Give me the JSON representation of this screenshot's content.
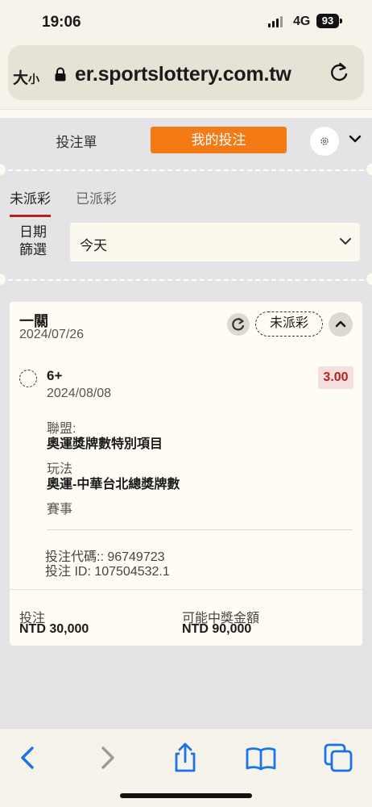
{
  "status_bar": {
    "time": "19:06",
    "network": "4G",
    "battery": "93"
  },
  "browser": {
    "text_size_label": "大",
    "text_size_small": "小",
    "url": "er.sportslottery.com.tw"
  },
  "tabs": {
    "betslip": "投注單",
    "my_bets": "我的投注"
  },
  "subtabs": {
    "unsettled": "未派彩",
    "settled": "已派彩"
  },
  "filter": {
    "label": "日期\n篩選",
    "label_line1": "日期",
    "label_line2": "篩選",
    "value": "今天"
  },
  "bet": {
    "type": "一關",
    "date": "2024/07/26",
    "status": "未派彩",
    "selection": {
      "name": "6+",
      "date": "2024/08/08",
      "odds": "3.00",
      "league_label": "聯盟:",
      "league": "奧運獎牌數特別項目",
      "market_label": "玩法",
      "market": "奧運-中華台北總獎牌數",
      "event_label": "賽事"
    },
    "code_line": "投注代碼:: 96749723",
    "id_line": "投注 ID: 107504532.1",
    "stake_label": "投注",
    "stake_value": "NTD 30,000",
    "payout_label": "可能中獎金額",
    "payout_value": "NTD 90,000"
  },
  "colors": {
    "accent": "#f47a16",
    "underline": "#b5231f",
    "link_blue": "#1a73e8"
  }
}
